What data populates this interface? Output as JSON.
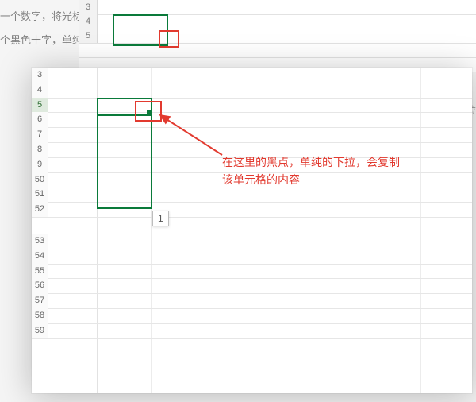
{
  "background": {
    "text_line1": "一个数字，将光标放在小",
    "text_line2": "个黑色十字，单纯的选择",
    "right_fragment": "下拉",
    "row_labels": [
      "3",
      "4",
      "5"
    ]
  },
  "card": {
    "row_labels": [
      "3",
      "4",
      "5",
      "6",
      "7",
      "8",
      "9",
      "50",
      "51",
      "52",
      "53",
      "54",
      "55",
      "56",
      "57",
      "58",
      "59"
    ],
    "active_row_index": 2,
    "selected_cell_value": "",
    "tooltip_value": "1",
    "annotation_line1": "在这里的黑点，单纯的下拉，会复制",
    "annotation_line2": "该单元格的内容"
  }
}
